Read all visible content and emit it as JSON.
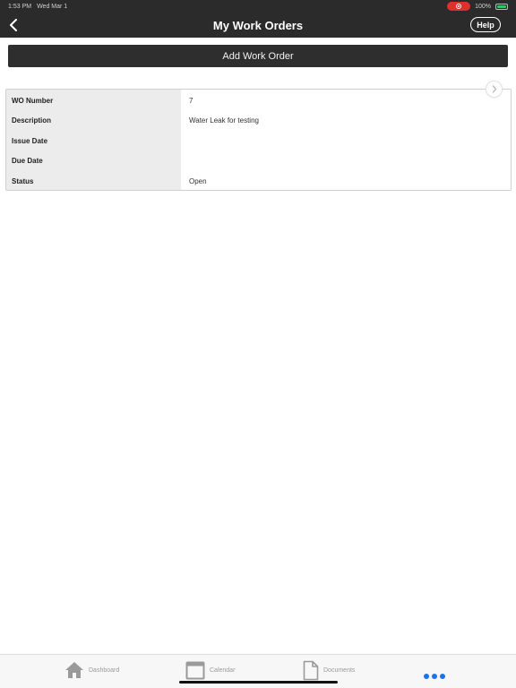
{
  "status_bar": {
    "time": "1:53 PM",
    "date": "Wed Mar 1",
    "battery": "100%"
  },
  "nav": {
    "title": "My Work Orders",
    "help_label": "Help"
  },
  "add_button_label": "Add Work Order",
  "work_order": {
    "labels": [
      "WO Number",
      "Description",
      "Issue Date",
      "Due Date",
      "Status"
    ],
    "values": [
      "7",
      "Water Leak for testing",
      "",
      "",
      "Open"
    ],
    "status_color": "#e0302a"
  },
  "tabs": [
    {
      "label": "Dashboard",
      "icon": "house-icon"
    },
    {
      "label": "Calendar",
      "icon": "calendar-icon"
    },
    {
      "label": "Documents",
      "icon": "document-icon"
    }
  ],
  "colors": {
    "header_bg": "#2b2b2b",
    "accent_blue": "#1a73e8",
    "status_red": "#e0302a"
  }
}
